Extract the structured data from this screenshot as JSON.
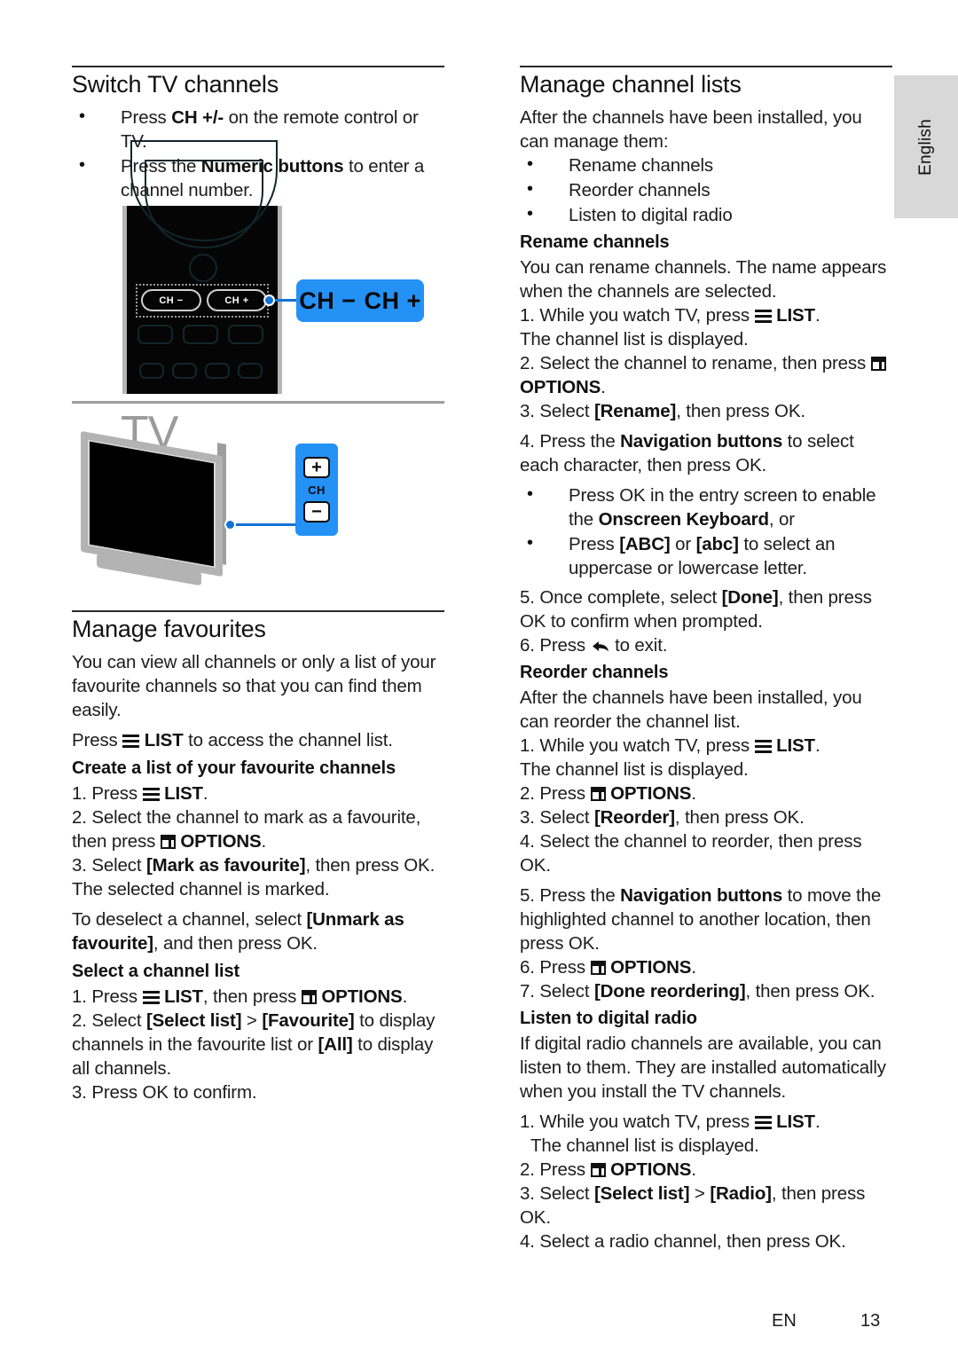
{
  "page": {
    "language_tab": "English",
    "footer_locale": "EN",
    "footer_page": "13"
  },
  "icons": {
    "list": "list-icon",
    "options": "options-icon",
    "back": "back-icon"
  },
  "left_column": {
    "section1": {
      "title": "Switch TV channels",
      "bullets": [
        {
          "pre": "Press ",
          "bold": "CH +/-",
          "post": " on the remote control or TV."
        },
        {
          "pre": "Press the ",
          "bold": "Numeric buttons",
          "post": " to enter a channel number."
        }
      ],
      "figure_remote": {
        "button_minus": "CH −",
        "button_plus": "CH +",
        "callout_minus": "CH −",
        "callout_plus": "CH +"
      },
      "figure_tv": {
        "label": "TV",
        "key_plus": "+",
        "key_ch": "CH",
        "key_minus": "−"
      }
    },
    "section2": {
      "title": "Manage favourites",
      "intro": "You can view all channels or only a list of your favourite channels so that you can find them easily.",
      "press_list_pre": "Press ",
      "press_list_label": "LIST",
      "press_list_post": " to access the channel list.",
      "sub1": {
        "heading": "Create a list of your favourite channels",
        "step1_pre": "1. Press ",
        "step1_label": "LIST",
        "step1_post": ".",
        "step2_pre": "2. Select the channel to mark as a favourite, then press ",
        "step2_label": "OPTIONS",
        "step2_post": ".",
        "step3_pre": "3. Select ",
        "step3_bold": "[Mark as favourite]",
        "step3_post": ", then press OK. The selected channel is marked.",
        "note_pre": "To deselect a channel, select ",
        "note_bold": "[Unmark as favourite]",
        "note_post": ", and then press OK."
      },
      "sub2": {
        "heading": "Select a channel list",
        "step1_pre": "1. Press ",
        "step1_label1": "LIST",
        "step1_mid": ", then press ",
        "step1_label2": "OPTIONS",
        "step1_post": ".",
        "step2_pre": "2. Select ",
        "step2_bold1": "[Select list]",
        "step2_mid": " > ",
        "step2_bold2": "[Favourite]",
        "step2_mid2": " to display channels in the favourite list or ",
        "step2_bold3": "[All]",
        "step2_post": " to display all channels.",
        "step3": "3. Press OK to confirm."
      }
    }
  },
  "right_column": {
    "section1": {
      "title": "Manage channel lists",
      "intro": "After the channels have been installed, you can manage them:",
      "bullets": [
        "Rename channels",
        "Reorder channels",
        "Listen to digital radio"
      ],
      "rename": {
        "heading": "Rename channels",
        "intro": "You can rename channels. The name appears when the channels are selected.",
        "step1_pre": "1. While you watch TV, press ",
        "step1_label": "LIST",
        "step1_post": ".",
        "step1_note": "The channel list is displayed.",
        "step2_pre": "2. Select the channel to rename, then press ",
        "step2_label": "OPTIONS",
        "step2_post": ".",
        "step3_pre": "3. Select ",
        "step3_bold": "[Rename]",
        "step3_post": ", then press OK.",
        "step4_pre": "4. Press the ",
        "step4_bold": "Navigation buttons",
        "step4_post": " to select each character, then press OK.",
        "sub_bullets": [
          {
            "pre": "Press OK in the entry screen to enable the ",
            "bold": "Onscreen Keyboard",
            "post": ", or"
          },
          {
            "pre": "Press ",
            "bold": "[ABC]",
            "mid": " or ",
            "bold2": "[abc]",
            "post": " to select an uppercase or lowercase letter."
          }
        ],
        "step5_pre": "5. Once complete, select ",
        "step5_bold": "[Done]",
        "step5_post": ", then press OK to confirm when prompted.",
        "step6_pre": "6. Press ",
        "step6_post": " to exit."
      },
      "reorder": {
        "heading": "Reorder channels",
        "intro": "After the channels have been installed, you can reorder the channel list.",
        "step1_pre": "1. While you watch TV, press ",
        "step1_label": "LIST",
        "step1_post": ".",
        "step1_note": "The channel list is displayed.",
        "step2_pre": "2. Press ",
        "step2_label": "OPTIONS",
        "step2_post": ".",
        "step3_pre": "3. Select ",
        "step3_bold": "[Reorder]",
        "step3_post": ", then press OK.",
        "step4": "4. Select the channel to reorder, then press OK.",
        "step5_pre": "5. Press the ",
        "step5_bold": "Navigation buttons",
        "step5_post": " to move the highlighted channel to another location, then press OK.",
        "step6_pre": "6. Press ",
        "step6_label": "OPTIONS",
        "step6_post": ".",
        "step7_pre": "7. Select ",
        "step7_bold": "[Done reordering]",
        "step7_post": ", then press OK."
      },
      "radio": {
        "heading": "Listen to digital radio",
        "intro": "If digital radio channels are available, you can listen to them. They are installed automatically when you install the TV channels.",
        "step1_pre": "1. While you watch TV, press ",
        "step1_label": "LIST",
        "step1_post": ".",
        "step1_note": "The channel list is displayed.",
        "step2_pre": "2. Press ",
        "step2_label": "OPTIONS",
        "step2_post": ".",
        "step3_pre": "3. Select ",
        "step3_bold1": "[Select list]",
        "step3_mid": " > ",
        "step3_bold2": "[Radio]",
        "step3_post": ", then press OK.",
        "step4": "4. Select a radio channel, then press OK."
      }
    }
  }
}
